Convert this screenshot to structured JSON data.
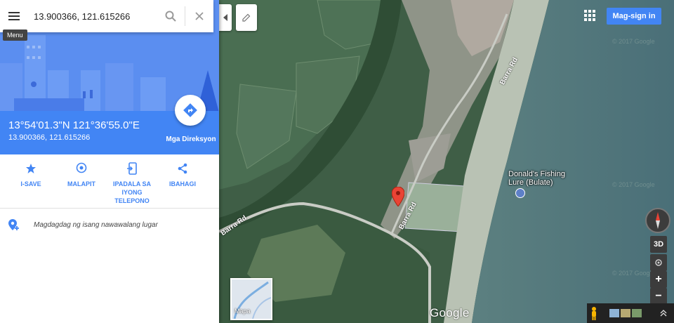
{
  "search": {
    "value": "13.900366, 121.615266",
    "menu_tooltip": "Menu"
  },
  "place": {
    "dms": "13°54'01.3\"N 121°36'55.0\"E",
    "decimal": "13.900366, 121.615266",
    "directions_label": "Mga Direksyon"
  },
  "actions": [
    {
      "label": "I-SAVE",
      "icon": "star-icon"
    },
    {
      "label": "MALAPIT",
      "icon": "nearby-icon"
    },
    {
      "label": "IPADALA SA\nIYONG\nTELEPONO",
      "icon": "send-to-phone-icon"
    },
    {
      "label": "IBAHAGI",
      "icon": "share-icon"
    }
  ],
  "add_missing_place": "Magdagdag ng isang nawawalang lugar",
  "map": {
    "signin_label": "Mag-sign in",
    "poi_name_line1": "Donald's Fishing",
    "poi_name_line2": "Lure (Bulate)",
    "road_labels": [
      "Barra Rd",
      "Barra Rd",
      "Barra Rd"
    ],
    "watermark": "© 2017 Google",
    "minimap_label": "Mapa",
    "google_logo": "Google",
    "ctrl_3d": "3D",
    "ctrl_plus": "+",
    "ctrl_minus": "−",
    "colors": {
      "accent": "#4285f4",
      "panel_hero": "#5b8ef0",
      "pin": "#ea4335"
    }
  }
}
